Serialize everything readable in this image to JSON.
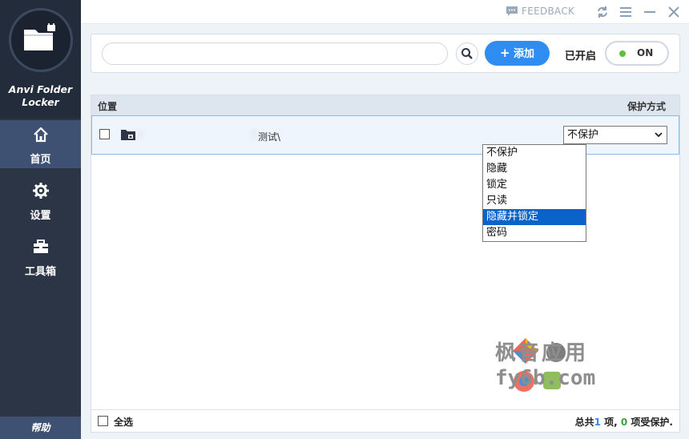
{
  "app": {
    "name": "Anvi Folder Locker",
    "name_line1": "Anvi Folder",
    "name_line2": "Locker"
  },
  "titlebar": {
    "feedback_label": "FEEDBACK",
    "icons": [
      "feedback-icon",
      "refresh-icon",
      "menu-icon",
      "minimize-icon",
      "close-icon"
    ]
  },
  "sidebar": {
    "items": [
      {
        "label": "首页",
        "icon": "home-icon",
        "active": true
      },
      {
        "label": "设置",
        "icon": "gear-icon",
        "active": false
      },
      {
        "label": "工具箱",
        "icon": "toolbox-icon",
        "active": false
      }
    ],
    "help_label": "帮助"
  },
  "toolbar": {
    "search_placeholder": "",
    "add_label": "添加",
    "enabled_label": "已开启",
    "toggle_label": "ON"
  },
  "list": {
    "columns": {
      "location": "位置",
      "protection": "保护方式"
    },
    "rows": [
      {
        "path": "测试\\",
        "protection": "不保护",
        "checked": false
      }
    ]
  },
  "dropdown": {
    "options": [
      "不保护",
      "隐藏",
      "锁定",
      "只读",
      "隐藏并锁定",
      "密码"
    ],
    "highlighted": "隐藏并锁定"
  },
  "footer": {
    "select_all_label": "全选",
    "summary_prefix": "总共",
    "total_count": "1",
    "summary_middle": " 项, ",
    "protected_count": "0",
    "summary_suffix": " 项受保护."
  },
  "watermark": {
    "line1": "枫音应用",
    "line2": "fy6b.com"
  },
  "colors": {
    "sidebar_bg": "#2b3545",
    "sidebar_active": "#3e5173",
    "accent_blue": "#2f8cf0",
    "toggle_dot": "#5bc236",
    "dropdown_highlight": "#0a63c9"
  }
}
